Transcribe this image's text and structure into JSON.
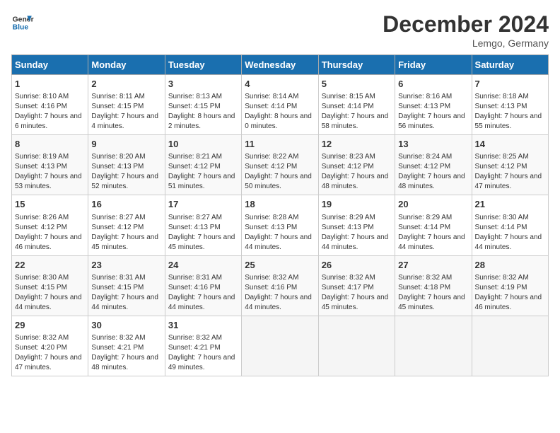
{
  "logo": {
    "line1": "General",
    "line2": "Blue"
  },
  "title": "December 2024",
  "subtitle": "Lemgo, Germany",
  "headers": [
    "Sunday",
    "Monday",
    "Tuesday",
    "Wednesday",
    "Thursday",
    "Friday",
    "Saturday"
  ],
  "weeks": [
    [
      {
        "day": "1",
        "sunrise": "8:10 AM",
        "sunset": "4:16 PM",
        "daylight": "7 hours and 6 minutes."
      },
      {
        "day": "2",
        "sunrise": "8:11 AM",
        "sunset": "4:15 PM",
        "daylight": "7 hours and 4 minutes."
      },
      {
        "day": "3",
        "sunrise": "8:13 AM",
        "sunset": "4:15 PM",
        "daylight": "8 hours and 2 minutes."
      },
      {
        "day": "4",
        "sunrise": "8:14 AM",
        "sunset": "4:14 PM",
        "daylight": "8 hours and 0 minutes."
      },
      {
        "day": "5",
        "sunrise": "8:15 AM",
        "sunset": "4:14 PM",
        "daylight": "7 hours and 58 minutes."
      },
      {
        "day": "6",
        "sunrise": "8:16 AM",
        "sunset": "4:13 PM",
        "daylight": "7 hours and 56 minutes."
      },
      {
        "day": "7",
        "sunrise": "8:18 AM",
        "sunset": "4:13 PM",
        "daylight": "7 hours and 55 minutes."
      }
    ],
    [
      {
        "day": "8",
        "sunrise": "8:19 AM",
        "sunset": "4:13 PM",
        "daylight": "7 hours and 53 minutes."
      },
      {
        "day": "9",
        "sunrise": "8:20 AM",
        "sunset": "4:13 PM",
        "daylight": "7 hours and 52 minutes."
      },
      {
        "day": "10",
        "sunrise": "8:21 AM",
        "sunset": "4:12 PM",
        "daylight": "7 hours and 51 minutes."
      },
      {
        "day": "11",
        "sunrise": "8:22 AM",
        "sunset": "4:12 PM",
        "daylight": "7 hours and 50 minutes."
      },
      {
        "day": "12",
        "sunrise": "8:23 AM",
        "sunset": "4:12 PM",
        "daylight": "7 hours and 48 minutes."
      },
      {
        "day": "13",
        "sunrise": "8:24 AM",
        "sunset": "4:12 PM",
        "daylight": "7 hours and 48 minutes."
      },
      {
        "day": "14",
        "sunrise": "8:25 AM",
        "sunset": "4:12 PM",
        "daylight": "7 hours and 47 minutes."
      }
    ],
    [
      {
        "day": "15",
        "sunrise": "8:26 AM",
        "sunset": "4:12 PM",
        "daylight": "7 hours and 46 minutes."
      },
      {
        "day": "16",
        "sunrise": "8:27 AM",
        "sunset": "4:12 PM",
        "daylight": "7 hours and 45 minutes."
      },
      {
        "day": "17",
        "sunrise": "8:27 AM",
        "sunset": "4:13 PM",
        "daylight": "7 hours and 45 minutes."
      },
      {
        "day": "18",
        "sunrise": "8:28 AM",
        "sunset": "4:13 PM",
        "daylight": "7 hours and 44 minutes."
      },
      {
        "day": "19",
        "sunrise": "8:29 AM",
        "sunset": "4:13 PM",
        "daylight": "7 hours and 44 minutes."
      },
      {
        "day": "20",
        "sunrise": "8:29 AM",
        "sunset": "4:14 PM",
        "daylight": "7 hours and 44 minutes."
      },
      {
        "day": "21",
        "sunrise": "8:30 AM",
        "sunset": "4:14 PM",
        "daylight": "7 hours and 44 minutes."
      }
    ],
    [
      {
        "day": "22",
        "sunrise": "8:30 AM",
        "sunset": "4:15 PM",
        "daylight": "7 hours and 44 minutes."
      },
      {
        "day": "23",
        "sunrise": "8:31 AM",
        "sunset": "4:15 PM",
        "daylight": "7 hours and 44 minutes."
      },
      {
        "day": "24",
        "sunrise": "8:31 AM",
        "sunset": "4:16 PM",
        "daylight": "7 hours and 44 minutes."
      },
      {
        "day": "25",
        "sunrise": "8:32 AM",
        "sunset": "4:16 PM",
        "daylight": "7 hours and 44 minutes."
      },
      {
        "day": "26",
        "sunrise": "8:32 AM",
        "sunset": "4:17 PM",
        "daylight": "7 hours and 45 minutes."
      },
      {
        "day": "27",
        "sunrise": "8:32 AM",
        "sunset": "4:18 PM",
        "daylight": "7 hours and 45 minutes."
      },
      {
        "day": "28",
        "sunrise": "8:32 AM",
        "sunset": "4:19 PM",
        "daylight": "7 hours and 46 minutes."
      }
    ],
    [
      {
        "day": "29",
        "sunrise": "8:32 AM",
        "sunset": "4:20 PM",
        "daylight": "7 hours and 47 minutes."
      },
      {
        "day": "30",
        "sunrise": "8:32 AM",
        "sunset": "4:21 PM",
        "daylight": "7 hours and 48 minutes."
      },
      {
        "day": "31",
        "sunrise": "8:32 AM",
        "sunset": "4:21 PM",
        "daylight": "7 hours and 49 minutes."
      },
      null,
      null,
      null,
      null
    ]
  ],
  "sunrise_label": "Sunrise:",
  "sunset_label": "Sunset:",
  "daylight_label": "Daylight:"
}
